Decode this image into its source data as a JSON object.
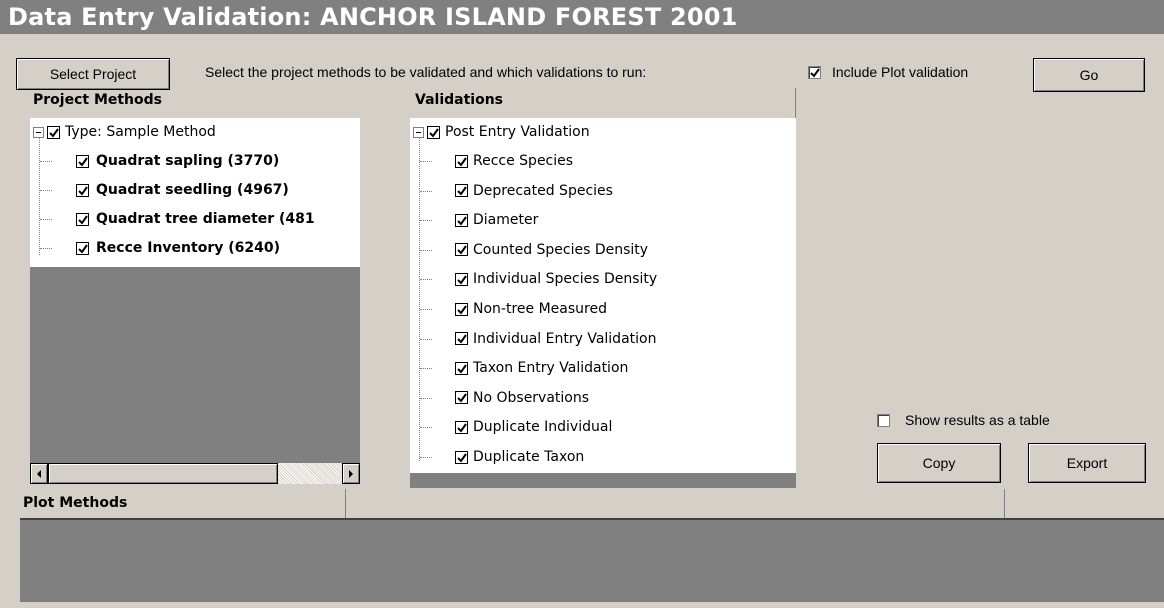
{
  "window": {
    "title": "Data Entry Validation: ANCHOR ISLAND FOREST 2001"
  },
  "toolbar": {
    "select_project_label": "Select Project",
    "instruction": "Select the project methods to be validated and which validations to run:",
    "include_plot_label": "Include Plot validation",
    "include_plot_checked": true,
    "go_label": "Go"
  },
  "project_methods": {
    "header": "Project Methods",
    "root": {
      "label": "Type: Sample Method",
      "checked": true
    },
    "items": [
      {
        "label": "Quadrat sapling (3770)",
        "checked": true
      },
      {
        "label": "Quadrat seedling (4967)",
        "checked": true
      },
      {
        "label": "Quadrat tree diameter (481",
        "checked": true
      },
      {
        "label": "Recce Inventory (6240)",
        "checked": true
      }
    ]
  },
  "validations": {
    "header": "Validations",
    "root": {
      "label": "Post Entry Validation",
      "checked": true
    },
    "items": [
      {
        "label": "Recce Species",
        "checked": true
      },
      {
        "label": "Deprecated Species",
        "checked": true
      },
      {
        "label": "Diameter",
        "checked": true
      },
      {
        "label": "Counted Species Density",
        "checked": true
      },
      {
        "label": "Individual Species Density",
        "checked": true
      },
      {
        "label": "Non-tree Measured",
        "checked": true
      },
      {
        "label": "Individual Entry Validation",
        "checked": true
      },
      {
        "label": "Taxon Entry Validation",
        "checked": true
      },
      {
        "label": "No Observations",
        "checked": true
      },
      {
        "label": "Duplicate Individual",
        "checked": true
      },
      {
        "label": "Duplicate Taxon",
        "checked": true
      }
    ]
  },
  "results": {
    "show_table_label": "Show results as a table",
    "show_table_checked": false,
    "copy_label": "Copy",
    "export_label": "Export"
  },
  "plot_methods": {
    "header": "Plot Methods"
  }
}
